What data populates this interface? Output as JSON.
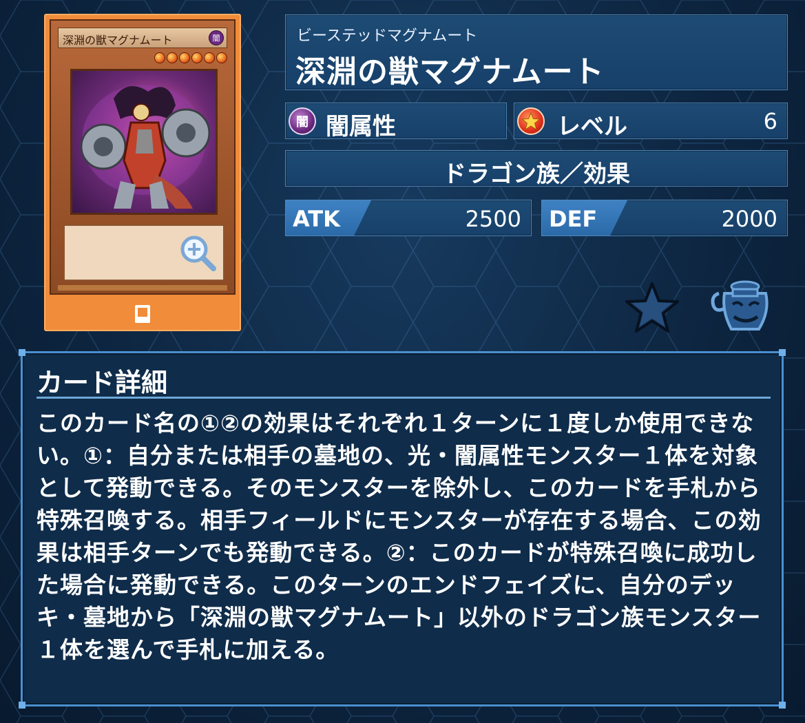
{
  "card": {
    "name_ruby": "ビーステッドマグナムート",
    "name": "深淵の獣マグナムート",
    "image_name": "深淵の獣マグナムート",
    "attribute_icon_char": "闇",
    "attribute": "闇属性",
    "level_label": "レベル",
    "level": "6",
    "type": "ドラゴン族／効果",
    "atk_label": "ATK",
    "atk": "2500",
    "def_label": "DEF",
    "def": "2000"
  },
  "detail": {
    "title": "カード詳細",
    "text": "このカード名の①②の効果はそれぞれ１ターンに１度しか使用できない。①：自分または相手の墓地の、光・闇属性モンスター１体を対象として発動できる。そのモンスターを除外し、このカードを手札から特殊召喚する。相手フィールドにモンスターが存在する場合、この効果は相手ターンでも発動できる。②：このカードが特殊召喚に成功した場合に発動できる。このターンのエンドフェイズに、自分のデッキ・墓地から「深淵の獣マグナムート」以外のドラゴン族モンスター１体を選んで手札に加える。"
  },
  "icons": {
    "zoom": "zoom-in-icon",
    "favorite": "star-icon",
    "pot": "pot-of-greed-icon",
    "rush": "card-icon"
  },
  "colors": {
    "accent": "#4a90d0",
    "frame_orange": "#f08c3a",
    "panel": "#1d4b74"
  }
}
